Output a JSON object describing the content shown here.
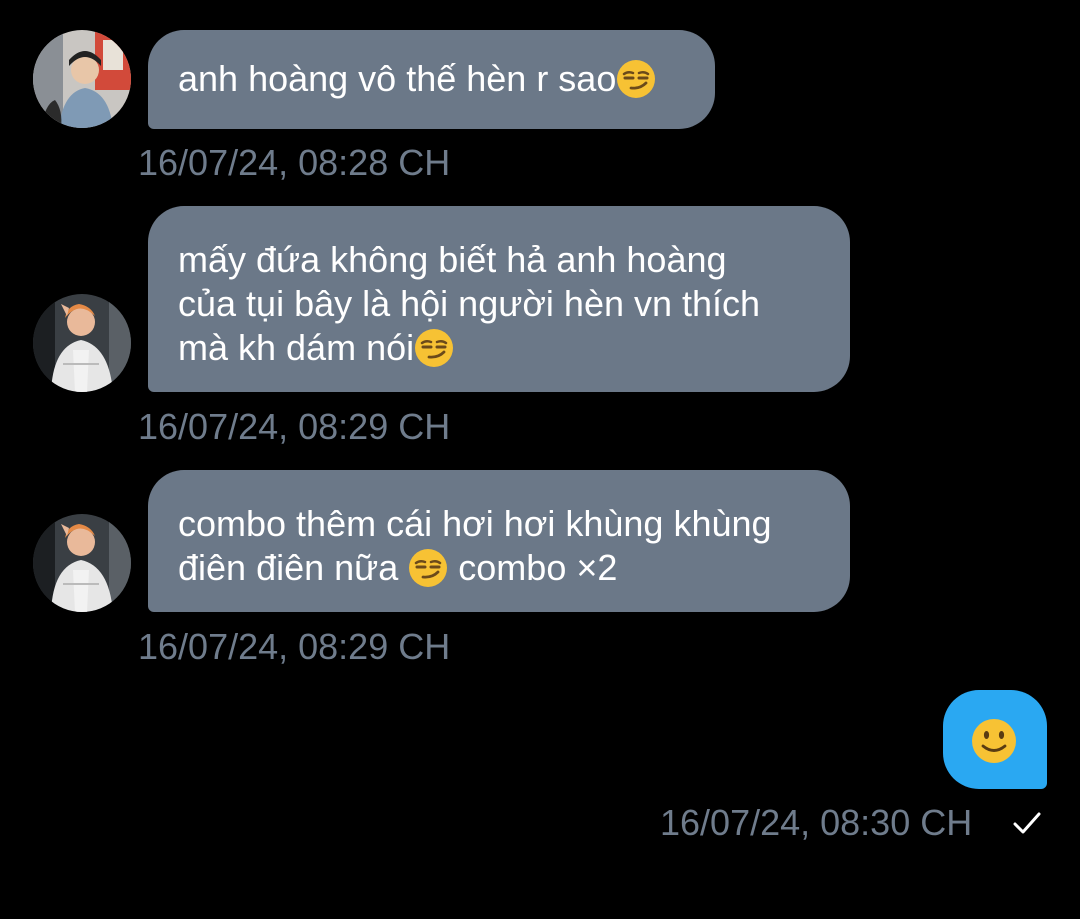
{
  "messages": [
    {
      "direction": "incoming",
      "text": "anh hoàng vô thế hèn r sao",
      "trailing_emoji": "smirking-face",
      "timestamp": "16/07/24, 08:28 CH"
    },
    {
      "direction": "incoming",
      "lines": [
        "mấy đứa không biết hả anh hoàng",
        "của tụi bây là hội người hèn vn thích",
        "mà kh dám nói"
      ],
      "trailing_emoji": "smirking-face",
      "timestamp": "16/07/24, 08:29 CH"
    },
    {
      "direction": "incoming",
      "lines": [
        "combo thêm cái hơi hơi khùng khùng",
        "điên điên nữa ",
        " combo ×2"
      ],
      "inline_emoji": "smirking-face",
      "timestamp": "16/07/24, 08:29 CH"
    },
    {
      "direction": "outgoing",
      "emoji": "slightly-smiling-face",
      "timestamp": "16/07/24, 08:30 CH",
      "status_icon": "check-icon"
    }
  ],
  "colors": {
    "background": "#000000",
    "incoming_bubble": "#6b7888",
    "outgoing_bubble": "#2aa8f2",
    "timestamp": "#6f7c8c",
    "text": "#ffffff"
  }
}
